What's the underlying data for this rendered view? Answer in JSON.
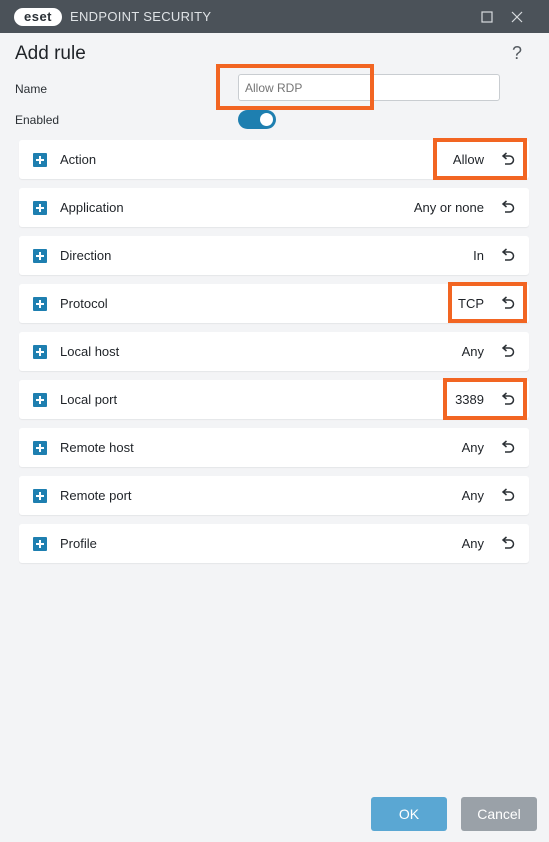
{
  "window": {
    "logo_text": "eset",
    "app_title": "ENDPOINT SECURITY",
    "maximize_icon": "maximize-icon",
    "close_icon": "close-icon"
  },
  "dialog": {
    "title": "Add rule",
    "help_label": "?"
  },
  "form": {
    "name_label": "Name",
    "name_value": "",
    "name_placeholder": "Allow RDP",
    "enabled_label": "Enabled",
    "enabled": true
  },
  "rules": [
    {
      "label": "Action",
      "value": "Allow"
    },
    {
      "label": "Application",
      "value": "Any or none"
    },
    {
      "label": "Direction",
      "value": "In"
    },
    {
      "label": "Protocol",
      "value": "TCP"
    },
    {
      "label": "Local host",
      "value": "Any"
    },
    {
      "label": "Local port",
      "value": "3389"
    },
    {
      "label": "Remote host",
      "value": "Any"
    },
    {
      "label": "Remote port",
      "value": "Any"
    },
    {
      "label": "Profile",
      "value": "Any"
    }
  ],
  "buttons": {
    "ok": "OK",
    "cancel": "Cancel"
  },
  "colors": {
    "accent": "#1e7fb0",
    "highlight": "#f26522",
    "titlebar": "#4b5259",
    "ok_button": "#5aa7d3",
    "cancel_button": "#9aa1a8"
  }
}
